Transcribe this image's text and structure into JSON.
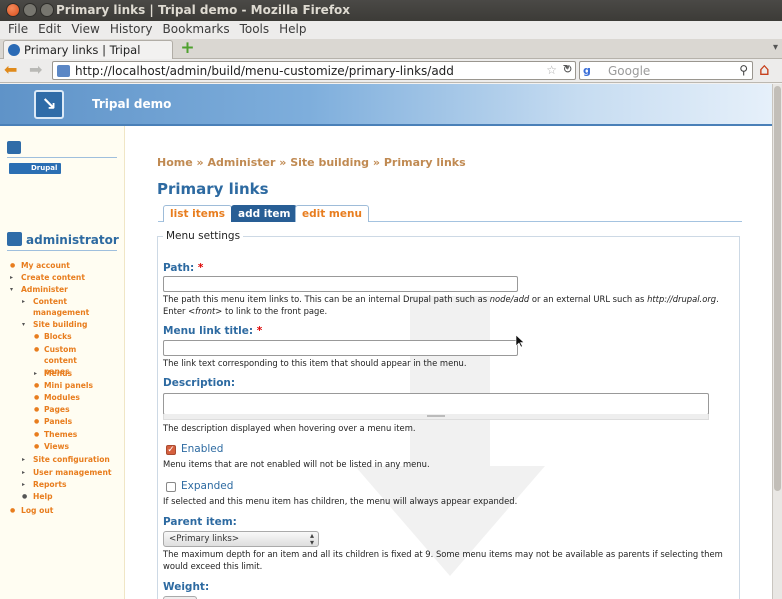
{
  "window": {
    "title": "Primary links | Tripal demo - Mozilla Firefox"
  },
  "menubar": [
    "File",
    "Edit",
    "View",
    "History",
    "Bookmarks",
    "Tools",
    "Help"
  ],
  "tab": {
    "title": "Primary links | Tripal demo",
    "new_tab": "+"
  },
  "navbar": {
    "url": "http://localhost/admin/build/menu-customize/primary-links/add",
    "search_placeholder": "Google",
    "search_engine": "g"
  },
  "site": {
    "name": "Tripal demo",
    "logo_glyph": "↘"
  },
  "sidebar": {
    "badge": "Drupal",
    "user": "administrator",
    "nav": [
      {
        "label": "My account",
        "bullet": "●"
      },
      {
        "label": "Create content",
        "bullet": "▸"
      },
      {
        "label": "Administer",
        "bullet": "▾"
      },
      {
        "label": "Content management",
        "bullet": "▸"
      },
      {
        "label": "Site building",
        "bullet": "▾"
      },
      {
        "label": "Blocks",
        "bullet": "●"
      },
      {
        "label": "Custom content panes",
        "bullet": "●"
      },
      {
        "label": "Menus",
        "bullet": "▸"
      },
      {
        "label": "Mini panels",
        "bullet": "●"
      },
      {
        "label": "Modules",
        "bullet": "●"
      },
      {
        "label": "Pages",
        "bullet": "●"
      },
      {
        "label": "Panels",
        "bullet": "●"
      },
      {
        "label": "Themes",
        "bullet": "●"
      },
      {
        "label": "Views",
        "bullet": "●"
      },
      {
        "label": "Site configuration",
        "bullet": "▸"
      },
      {
        "label": "User management",
        "bullet": "▸"
      },
      {
        "label": "Reports",
        "bullet": "▸"
      },
      {
        "label": "Help",
        "bullet": "●"
      },
      {
        "label": "Log out",
        "bullet": "●"
      }
    ]
  },
  "breadcrumb": [
    "Home",
    "Administer",
    "Site building",
    "Primary links"
  ],
  "breadcrumb_sep": "»",
  "page": {
    "title": "Primary links",
    "tabs": [
      "list items",
      "add item",
      "edit menu"
    ],
    "active_tab": "add item"
  },
  "form": {
    "legend": "Menu settings",
    "path": {
      "label": "Path:",
      "required": "*",
      "value": "",
      "desc_1": "The path this menu item links to. This can be an internal Drupal path such as ",
      "desc_em1": "node/add",
      "desc_2": " or an external URL such as ",
      "desc_em2": "http://drupal.org",
      "desc_3": ". Enter ",
      "desc_em3": "<front>",
      "desc_4": " to link to the front page."
    },
    "title": {
      "label": "Menu link title:",
      "required": "*",
      "value": "",
      "desc": "The link text corresponding to this item that should appear in the menu."
    },
    "description": {
      "label": "Description:",
      "value": "",
      "desc": "The description displayed when hovering over a menu item."
    },
    "enabled": {
      "label": "Enabled",
      "checked": true,
      "desc": "Menu items that are not enabled will not be listed in any menu."
    },
    "expanded": {
      "label": "Expanded",
      "checked": false,
      "desc": "If selected and this menu item has children, the menu will always appear expanded."
    },
    "parent": {
      "label": "Parent item:",
      "selected": "<Primary links>",
      "desc": "The maximum depth for an item and all its children is fixed at 9. Some menu items may not be available as parents if selecting them would exceed this limit."
    },
    "weight": {
      "label": "Weight:"
    }
  },
  "colors": {
    "accent_orange": "#e87d1e",
    "link_blue": "#2d6aa1",
    "tab_active": "#285e95"
  }
}
